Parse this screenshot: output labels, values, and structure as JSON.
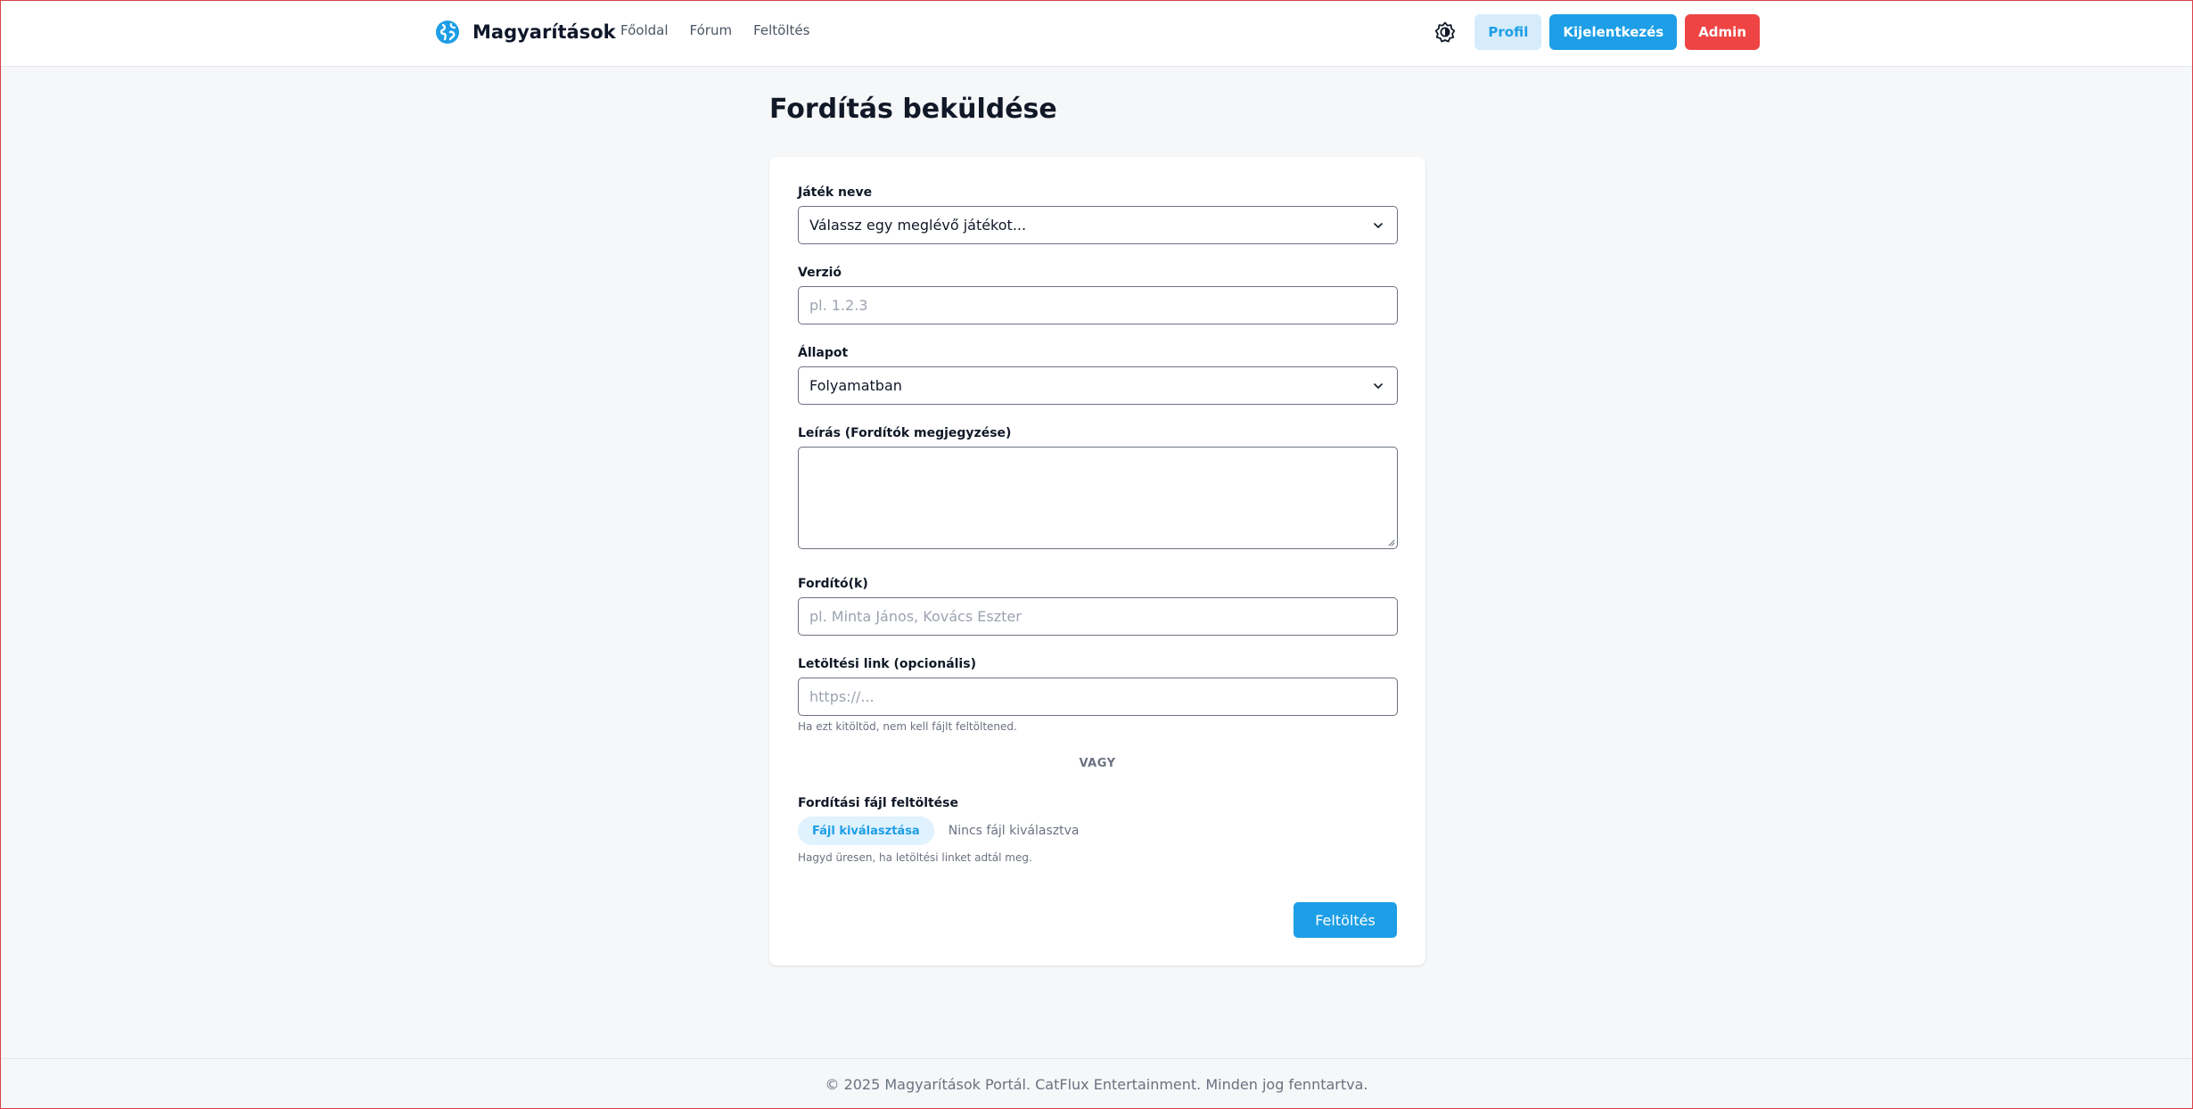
{
  "header": {
    "brand": "Magyarítások",
    "nav": [
      "Főoldal",
      "Fórum",
      "Feltöltés"
    ],
    "profile_label": "Profil",
    "logout_label": "Kijelentkezés",
    "admin_label": "Admin"
  },
  "page": {
    "title": "Fordítás beküldése"
  },
  "form": {
    "game": {
      "label": "Játék neve",
      "selected": "Válassz egy meglévő játékot..."
    },
    "version": {
      "label": "Verzió",
      "placeholder": "pl. 1.2.3"
    },
    "status": {
      "label": "Állapot",
      "selected": "Folyamatban"
    },
    "description": {
      "label": "Leírás (Fordítók megjegyzése)",
      "value": ""
    },
    "translators": {
      "label": "Fordító(k)",
      "placeholder": "pl. Minta János, Kovács Eszter"
    },
    "download_link": {
      "label": "Letöltési link (opcionális)",
      "placeholder": "https://...",
      "helper": "Ha ezt kitöltöd, nem kell fájlt feltöltened."
    },
    "or_divider": "VAGY",
    "file_upload": {
      "label": "Fordítási fájl feltöltése",
      "button_label": "Fájl kiválasztása",
      "status": "Nincs fájl kiválasztva",
      "helper": "Hagyd üresen, ha letöltési linket adtál meg."
    },
    "submit_label": "Feltöltés"
  },
  "footer": {
    "text": "© 2025 Magyarítások Portál. CatFlux Entertainment. Minden jog fenntartva."
  },
  "colors": {
    "accent": "#1d9ee6",
    "danger": "#ef4444",
    "accent_light": "#d6ecfb"
  },
  "icons": {
    "brand": "globe-icon",
    "theme_toggle": "sun-moon-icon",
    "select": "chevron-down-icon"
  }
}
